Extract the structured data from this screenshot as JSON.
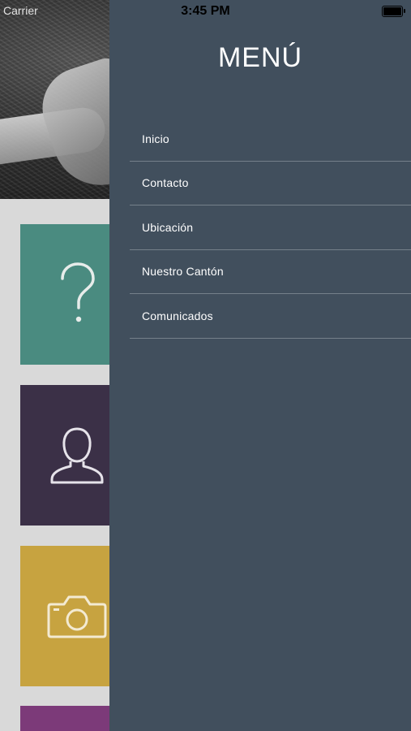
{
  "status_bar": {
    "carrier": "Carrier",
    "time": "3:45 PM"
  },
  "drawer": {
    "title": "MENÚ",
    "items": [
      {
        "label": "Inicio"
      },
      {
        "label": "Contacto"
      },
      {
        "label": "Ubicación"
      },
      {
        "label": "Nuestro Cantón"
      },
      {
        "label": "Comunicados"
      }
    ]
  },
  "tiles": [
    {
      "icon": "question-mark-icon",
      "color": "#4a8b80"
    },
    {
      "icon": "user-icon",
      "color": "#3b3047"
    },
    {
      "icon": "camera-icon",
      "color": "#c7a340"
    },
    {
      "icon": "",
      "color": "#7c3a79"
    }
  ],
  "colors": {
    "drawer_bg": "#414f5d",
    "divider": "rgba(255,255,255,0.28)",
    "app_bg": "#d9d9d9"
  }
}
